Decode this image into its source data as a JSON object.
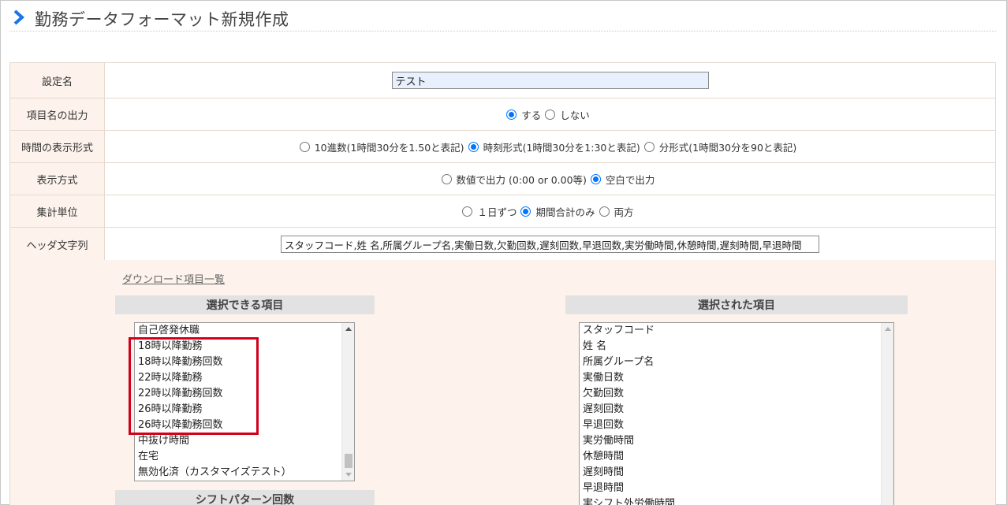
{
  "page": {
    "title": "勤務データフォーマット新規作成"
  },
  "form": {
    "setting_name": {
      "label": "設定名",
      "value": "テスト"
    },
    "item_name_output": {
      "label": "項目名の出力",
      "options": [
        {
          "label": "する",
          "checked": true
        },
        {
          "label": "しない",
          "checked": false
        }
      ]
    },
    "time_format": {
      "label": "時間の表示形式",
      "options": [
        {
          "label": "10進数(1時間30分を1.50と表記)",
          "checked": false
        },
        {
          "label": "時刻形式(1時間30分を1:30と表記)",
          "checked": true
        },
        {
          "label": "分形式(1時間30分を90と表記)",
          "checked": false
        }
      ]
    },
    "display_mode": {
      "label": "表示方式",
      "options": [
        {
          "label": "数値で出力 (0:00 or 0.00等)",
          "checked": false
        },
        {
          "label": "空白で出力",
          "checked": true
        }
      ]
    },
    "aggregation_unit": {
      "label": "集計単位",
      "options": [
        {
          "label": "１日ずつ",
          "checked": false
        },
        {
          "label": "期間合計のみ",
          "checked": true
        },
        {
          "label": "両方",
          "checked": false
        }
      ]
    },
    "header_string": {
      "label": "ヘッダ文字列",
      "value": "スタッフコード,姓 名,所属グループ名,実働日数,欠勤回数,遅刻回数,早退回数,実労働時間,休憩時間,遅刻時間,早退時間"
    }
  },
  "download": {
    "link_label": "ダウンロード項目一覧",
    "available_header": "選択できる項目",
    "selected_header": "選択された項目",
    "shift_header": "シフトパターン回数",
    "available_items": [
      "自己啓発休職",
      "18時以降勤務",
      "18時以降勤務回数",
      "22時以降勤務",
      "22時以降勤務回数",
      "26時以降勤務",
      "26時以降勤務回数",
      "中抜け時間",
      "在宅",
      "無効化済（カスタマイズテスト）"
    ],
    "selected_items": [
      "スタッフコード",
      "姓 名",
      "所属グループ名",
      "実働日数",
      "欠勤回数",
      "遅刻回数",
      "早退回数",
      "実労働時間",
      "休憩時間",
      "遅刻時間",
      "早退時間",
      "実シフト外労働時間"
    ]
  },
  "colors": {
    "accent_blue": "#0075ff",
    "title_chevron": "#1a73e8",
    "label_bg": "#fdf3ec",
    "highlight_red": "#d0021b"
  },
  "icons": {
    "title": "chevron-right-icon",
    "scroll_up": "arrow-up-icon",
    "scroll_down": "arrow-down-icon"
  }
}
